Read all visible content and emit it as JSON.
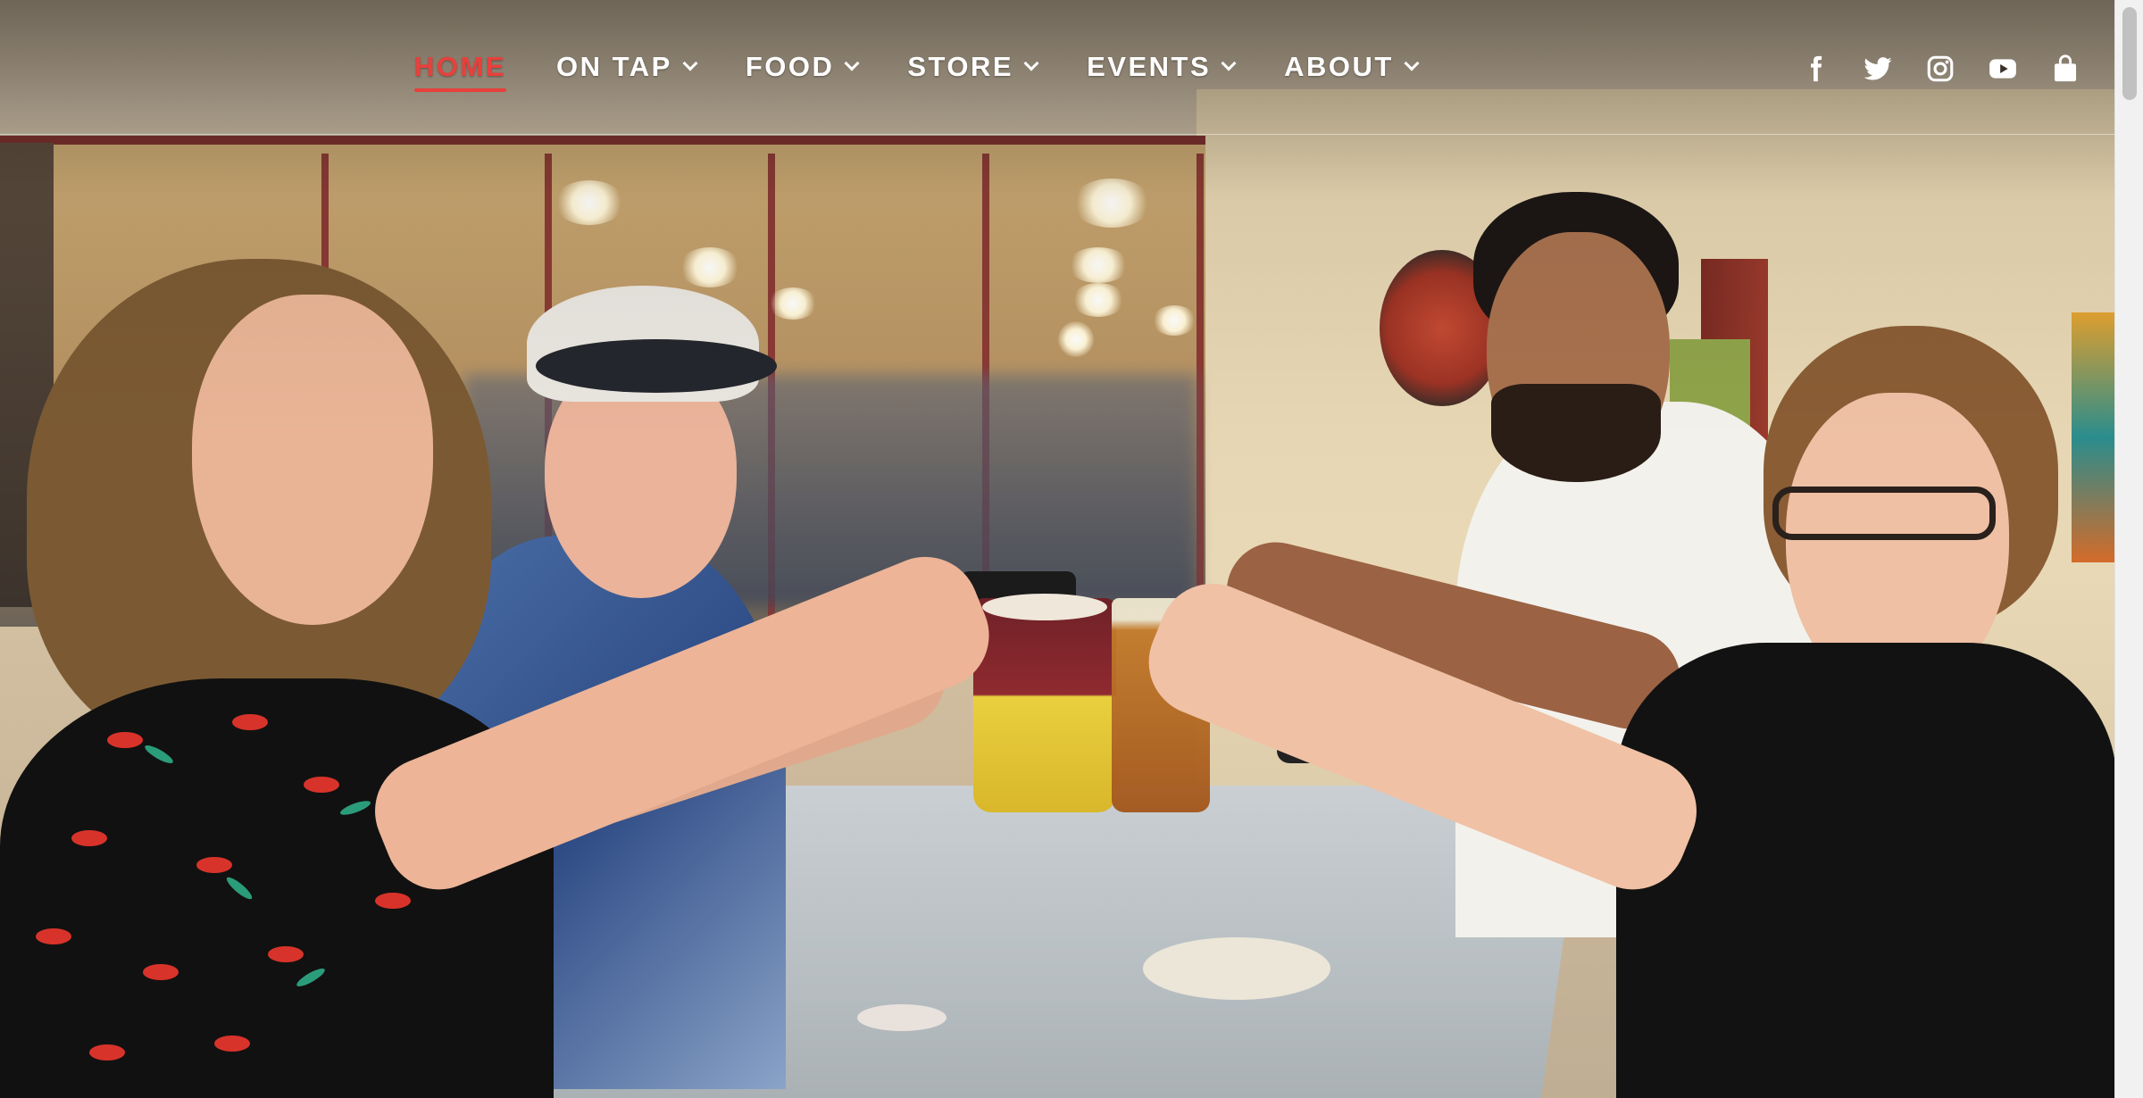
{
  "nav": {
    "items": [
      {
        "label": "HOME",
        "active": true,
        "has_dropdown": false
      },
      {
        "label": "ON TAP",
        "active": false,
        "has_dropdown": true
      },
      {
        "label": "FOOD",
        "active": false,
        "has_dropdown": true
      },
      {
        "label": "STORE",
        "active": false,
        "has_dropdown": true
      },
      {
        "label": "EVENTS",
        "active": false,
        "has_dropdown": true
      },
      {
        "label": "ABOUT",
        "active": false,
        "has_dropdown": true
      }
    ],
    "active_color": "#e8403c",
    "text_color": "#ffffff"
  },
  "social": {
    "icons": [
      "facebook-icon",
      "twitter-icon",
      "instagram-icon",
      "youtube-icon",
      "shopping-bag-icon"
    ]
  },
  "hero": {
    "image": "group-toast-photo"
  }
}
